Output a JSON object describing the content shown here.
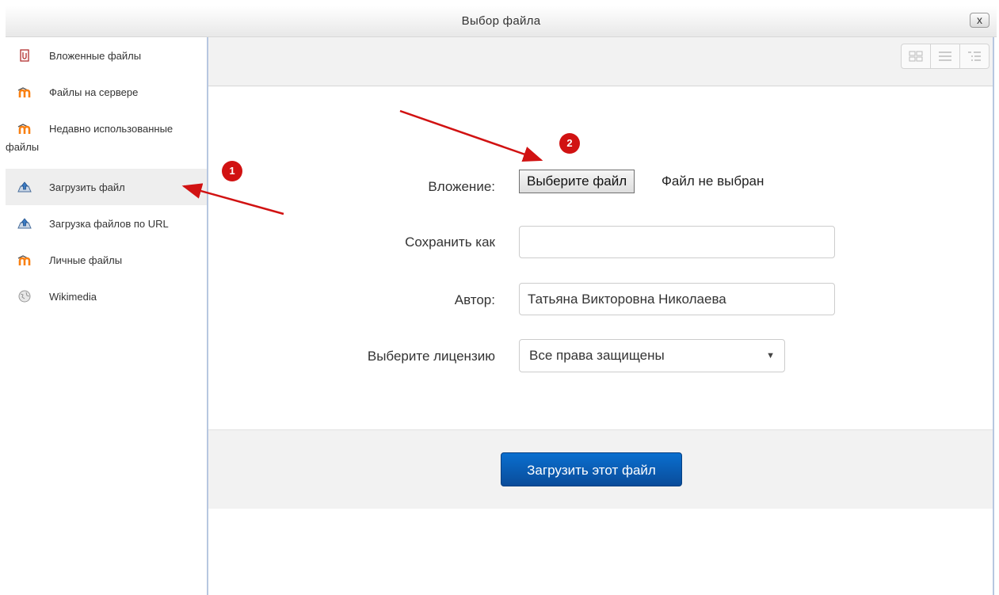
{
  "dialog": {
    "title": "Выбор файла",
    "close_label": "x"
  },
  "sidebar": {
    "items": [
      {
        "label": "Вложенные файлы",
        "icon": "attachment-icon"
      },
      {
        "label": "Файлы на сервере",
        "icon": "moodle-icon"
      },
      {
        "label": "Недавно использованные файлы",
        "icon": "moodle-icon"
      },
      {
        "label": "Загрузить файл",
        "icon": "upload-icon",
        "active": true
      },
      {
        "label": "Загрузка файлов по URL",
        "icon": "upload-icon"
      },
      {
        "label": "Личные файлы",
        "icon": "moodle-icon"
      },
      {
        "label": "Wikimedia",
        "icon": "wikimedia-icon"
      }
    ]
  },
  "toolbar": {
    "views": [
      "icons-view-icon",
      "list-view-icon",
      "tree-view-icon"
    ]
  },
  "form": {
    "attachment_label": "Вложение:",
    "choose_file_button": "Выберите файл",
    "file_status": "Файл не выбран",
    "save_as_label": "Сохранить как",
    "save_as_value": "",
    "author_label": "Автор:",
    "author_value": "Татьяна Викторовна Николаева",
    "license_label": "Выберите лицензию",
    "license_value": "Все права защищены",
    "submit_label": "Загрузить этот файл"
  },
  "annotations": {
    "badge1": "1",
    "badge2": "2",
    "color": "#d11212"
  },
  "colors": {
    "accent": "#0a5cb5",
    "frame": "#b7c7e0"
  }
}
